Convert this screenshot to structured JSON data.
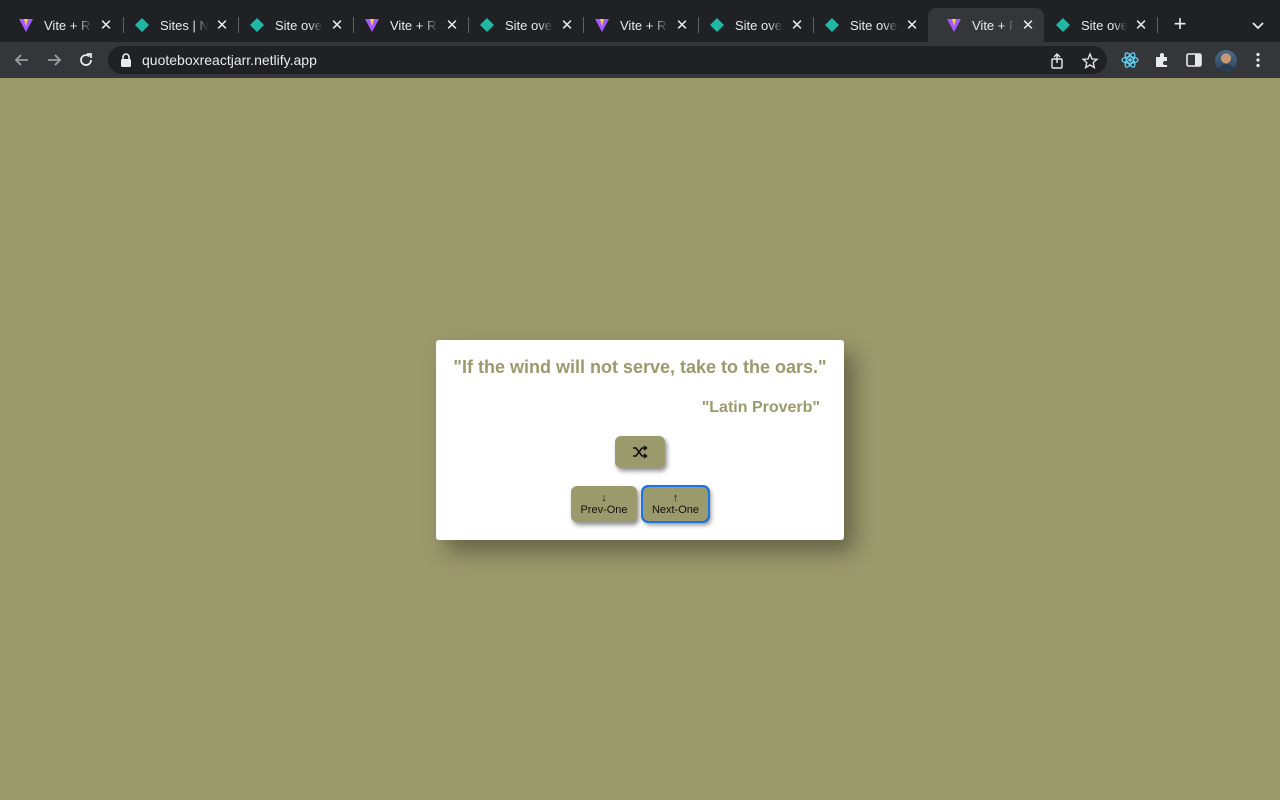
{
  "browser": {
    "tabs": [
      {
        "title": "Vite + React",
        "icon": "vite-icon"
      },
      {
        "title": "Sites | Netlify",
        "icon": "netlify-icon"
      },
      {
        "title": "Site overview",
        "icon": "netlify-icon"
      },
      {
        "title": "Vite + React",
        "icon": "vite-icon"
      },
      {
        "title": "Site overview",
        "icon": "netlify-icon"
      },
      {
        "title": "Vite + React",
        "icon": "vite-icon"
      },
      {
        "title": "Site overview",
        "icon": "netlify-icon"
      },
      {
        "title": "Site overview",
        "icon": "netlify-icon"
      },
      {
        "title": "Vite + React",
        "icon": "vite-icon",
        "active": true
      },
      {
        "title": "Site overview",
        "icon": "netlify-icon"
      }
    ],
    "url": "quoteboxreactjarr.netlify.app"
  },
  "quote_box": {
    "text": "\"If the wind will not serve, take to the oars.\"",
    "author": "\"Latin Proverb\"",
    "random_icon": "shuffle-icon",
    "prev_label": "Prev-One",
    "prev_arrow": "↓",
    "next_label": "Next-One",
    "next_arrow": "↑"
  },
  "colors": {
    "background": "#9b9a6c",
    "accent": "#9b9a6c",
    "card": "#ffffff"
  }
}
